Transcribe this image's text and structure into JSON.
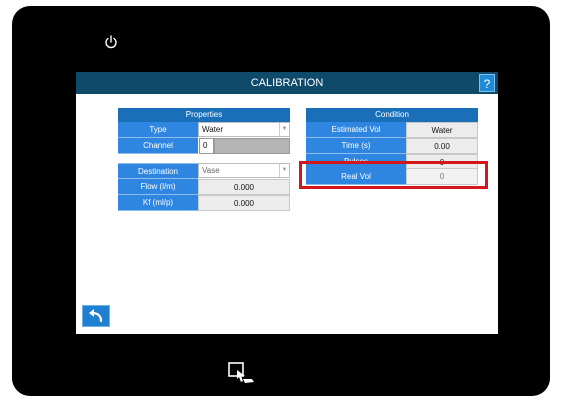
{
  "header": {
    "title": "CALIBRATION",
    "help_label": "?"
  },
  "properties": {
    "title": "Properties",
    "type_label": "Type",
    "type_value": "Water",
    "channel_label": "Channel",
    "channel_value": "0"
  },
  "destination": {
    "destination_label": "Destination",
    "destination_value": "Vase",
    "flow_label": "Flow (l/m)",
    "flow_value": "0.000",
    "kf_label": "Kf (ml/p)",
    "kf_value": "0.000"
  },
  "condition": {
    "title": "Condition",
    "estimated_vol_label": "Estimated Vol",
    "estimated_vol_value": "Water",
    "time_label": "Time (s)",
    "time_value": "0.00",
    "pulses_label": "Pulses",
    "pulses_value": "0",
    "real_vol_label": "Real Vol",
    "real_vol_value": "0"
  },
  "icons": {
    "power": "power-icon",
    "back": "back-arrow-icon",
    "touch": "touch-screen-icon",
    "dropdown": "chevron-down-icon"
  },
  "colors": {
    "title_bar": "#0f4a6b",
    "label_cell": "#2f86e0",
    "highlight": "#d4171d"
  }
}
